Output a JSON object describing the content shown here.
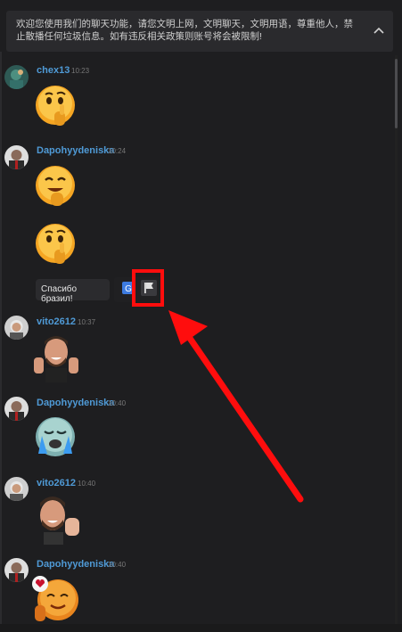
{
  "notice": {
    "text": "欢迎您使用我们的聊天功能，请您文明上网，文明聊天，文明用语，尊重他人，禁止散播任何垃圾信息。如有违反相关政策则账号将会被限制!"
  },
  "messages": [
    {
      "user": "chex13",
      "time": "10:23"
    },
    {
      "user": "Dapohyydeniska",
      "time": "10:24"
    },
    {
      "user": "vito2612",
      "time": "10:37"
    },
    {
      "user": "Dapohyydeniska",
      "time": "10:40"
    },
    {
      "user": "vito2612",
      "time": "10:40"
    },
    {
      "user": "Dapohyydeniska",
      "time": "10:40"
    }
  ],
  "tooltip": {
    "text": "Спасибо бразил!"
  },
  "icons": {
    "collapse": "chevron-up-icon",
    "translate": "translate-icon",
    "report": "flag-icon"
  },
  "colors": {
    "highlight": "#ff0d0d",
    "username": "#4f9ad6",
    "background": "#1e1e20"
  }
}
